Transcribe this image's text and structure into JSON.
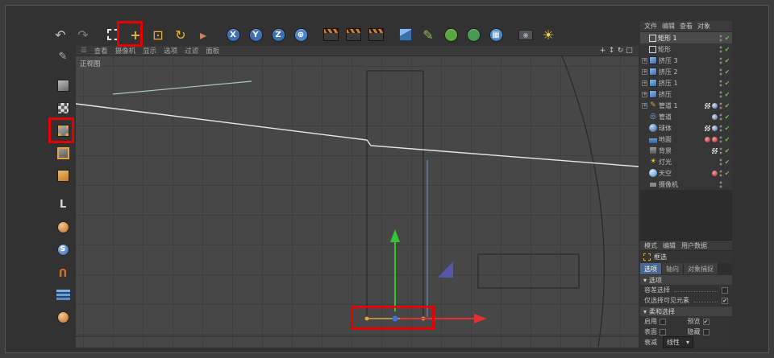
{
  "colors": {
    "annotation_red": "#e60000",
    "axis_y_green": "#35c435",
    "axis_x_red": "#e03030",
    "point_blue": "#3d6fe0",
    "point_orange": "#e0a43c",
    "selected_tab_blue": "#4a688f",
    "check_green": "#6fbf4f"
  },
  "top_toolbar": {
    "icons": [
      {
        "name": "undo-icon",
        "kind": "glyph",
        "glyph": "↶",
        "color": "#c0c0c0"
      },
      {
        "name": "redo-icon",
        "kind": "glyph",
        "glyph": "↷",
        "color": "#7d7d7d"
      },
      {
        "kind": "sep"
      },
      {
        "name": "rectangle-selection-tool-icon",
        "kind": "dashed-box",
        "annotated": true
      },
      {
        "name": "move-tool-icon",
        "kind": "glyph",
        "glyph": "+",
        "color": "#e8b63c",
        "bold": true
      },
      {
        "name": "scale-tool-icon",
        "kind": "glyph",
        "glyph": "⊡",
        "color": "#e8b63c"
      },
      {
        "name": "rotate-tool-icon",
        "kind": "glyph",
        "glyph": "↻",
        "color": "#e8b63c"
      },
      {
        "name": "last-used-tool-icon",
        "kind": "glyph",
        "glyph": "▸",
        "color": "#c8875a"
      },
      {
        "kind": "sep"
      },
      {
        "name": "x-axis-lock-icon",
        "kind": "circle",
        "glyph": "X",
        "bg": "#3d6fb4"
      },
      {
        "name": "y-axis-lock-icon",
        "kind": "circle",
        "glyph": "Y",
        "bg": "#3d6fb4"
      },
      {
        "name": "z-axis-lock-icon",
        "kind": "circle",
        "glyph": "Z",
        "bg": "#3d6fb4"
      },
      {
        "name": "coordinate-system-icon",
        "kind": "circle",
        "glyph": "⊕",
        "bg": "#4a86c8"
      },
      {
        "kind": "sep"
      },
      {
        "name": "render-view-icon",
        "kind": "clapper"
      },
      {
        "name": "render-to-picture-viewer-icon",
        "kind": "clapper"
      },
      {
        "name": "render-settings-icon",
        "kind": "clapper"
      },
      {
        "kind": "sep"
      },
      {
        "name": "primitive-cube-icon",
        "kind": "cube-blue"
      },
      {
        "name": "spline-pen-icon",
        "kind": "glyph",
        "glyph": "✎",
        "color": "#8fbf5f"
      },
      {
        "name": "subdivision-surface-icon",
        "kind": "circle",
        "glyph": "",
        "bg": "#58a83c"
      },
      {
        "name": "generator-icon",
        "kind": "circle",
        "glyph": "",
        "bg": "#4a9a50"
      },
      {
        "name": "deformer-icon",
        "kind": "circle",
        "glyph": "▦",
        "bg": "#4a86c8"
      },
      {
        "kind": "sep"
      },
      {
        "name": "scene-camera-icon",
        "kind": "camera"
      },
      {
        "name": "scene-light-icon",
        "kind": "glyph",
        "glyph": "☀",
        "color": "#e8d44c"
      }
    ]
  },
  "left_toolbar": {
    "icons": [
      {
        "name": "make-editable-icon",
        "kind": "glyph",
        "glyph": "✎",
        "color": "#b0b0b0"
      },
      {
        "kind": "sep"
      },
      {
        "name": "model-mode-icon",
        "kind": "cube"
      },
      {
        "name": "texture-mode-icon",
        "kind": "checker"
      },
      {
        "name": "points-mode-icon",
        "kind": "cube-dots",
        "annotated": true
      },
      {
        "name": "edges-mode-icon",
        "kind": "cube-edges"
      },
      {
        "name": "polygons-mode-icon",
        "kind": "cube-poly"
      },
      {
        "kind": "sep"
      },
      {
        "name": "axis-mode-icon",
        "kind": "glyph",
        "glyph": "L",
        "color": "#d8d8d8",
        "bold": true
      },
      {
        "name": "viewport-solo-icon",
        "kind": "ball-orange"
      },
      {
        "name": "snap-icon",
        "kind": "ball-blue",
        "glyph": "S"
      },
      {
        "name": "magnet-snap-icon",
        "kind": "glyph",
        "glyph": "U",
        "color": "#d86a2a",
        "bold": true,
        "flip": true
      },
      {
        "name": "workplane-icon",
        "kind": "layers"
      },
      {
        "name": "lock-workplane-icon",
        "kind": "ball-orange"
      }
    ]
  },
  "viewport": {
    "menu_items": [
      "查看",
      "摄像机",
      "显示",
      "选项",
      "过滤",
      "面板"
    ],
    "view_label": "正视图",
    "view_controls": [
      {
        "name": "pan-view-icon",
        "glyph": "+"
      },
      {
        "name": "zoom-view-icon",
        "glyph": "↕"
      },
      {
        "name": "rotate-view-icon",
        "glyph": "↻"
      },
      {
        "name": "toggle-view-icon",
        "glyph": "□"
      }
    ]
  },
  "object_manager": {
    "menu_items": [
      "文件",
      "编辑",
      "查看",
      "对象"
    ],
    "items": [
      {
        "label": "矩形 1",
        "icon": "spline-rect",
        "selected": true,
        "check": true,
        "tags": []
      },
      {
        "label": "矩形",
        "icon": "spline-rect",
        "check": true,
        "tags": []
      },
      {
        "label": "挤压 3",
        "icon": "extrude",
        "expand": true,
        "check": true,
        "tags": []
      },
      {
        "label": "挤压 2",
        "icon": "extrude",
        "expand": true,
        "check": true,
        "tags": []
      },
      {
        "label": "挤压 1",
        "icon": "extrude",
        "expand": true,
        "check": true,
        "tags": []
      },
      {
        "label": "挤压",
        "icon": "extrude",
        "expand": true,
        "check": true,
        "tags": []
      },
      {
        "label": "管道 1",
        "icon": "pen",
        "expand": true,
        "check": true,
        "tags": [
          "checker",
          "phong"
        ]
      },
      {
        "label": "管道",
        "icon": "tube",
        "check": true,
        "tags": [
          "phong"
        ]
      },
      {
        "label": "球体",
        "icon": "sphere",
        "check": true,
        "tags": [
          "checker",
          "phong"
        ]
      },
      {
        "label": "地面",
        "icon": "floor",
        "check": true,
        "tags": [
          "red",
          "red"
        ]
      },
      {
        "label": "背景",
        "icon": "background",
        "check": true,
        "tags": [
          "checker"
        ]
      },
      {
        "label": "灯光",
        "icon": "light",
        "check": true,
        "tags": []
      },
      {
        "label": "天空",
        "icon": "sky",
        "check": true,
        "tags": [
          "red"
        ]
      },
      {
        "label": "摄像机",
        "icon": "camera",
        "check": false,
        "tags": []
      }
    ]
  },
  "attribute_manager": {
    "menu_items": [
      "模式",
      "编辑",
      "用户数据"
    ],
    "tool_label": "框选",
    "tabs": [
      {
        "label": "选项",
        "active": true
      },
      {
        "label": "轴向",
        "active": false
      },
      {
        "label": "对象捕捉",
        "active": false
      }
    ],
    "options_section": {
      "title": "选项",
      "rows": [
        {
          "label": "容差选择",
          "checked": false
        },
        {
          "label": "仅选择可见元素",
          "checked": true
        }
      ]
    },
    "soft_section": {
      "title": "柔和选择",
      "rows2": [
        {
          "left": {
            "label": "启用",
            "checked": false
          },
          "right": {
            "label": "预览",
            "checked": true
          }
        },
        {
          "left": {
            "label": "表面",
            "checked": false
          },
          "right": {
            "label": "隐藏",
            "checked": false
          }
        }
      ],
      "falloff_label": "衰减",
      "falloff_value": "线性"
    }
  }
}
